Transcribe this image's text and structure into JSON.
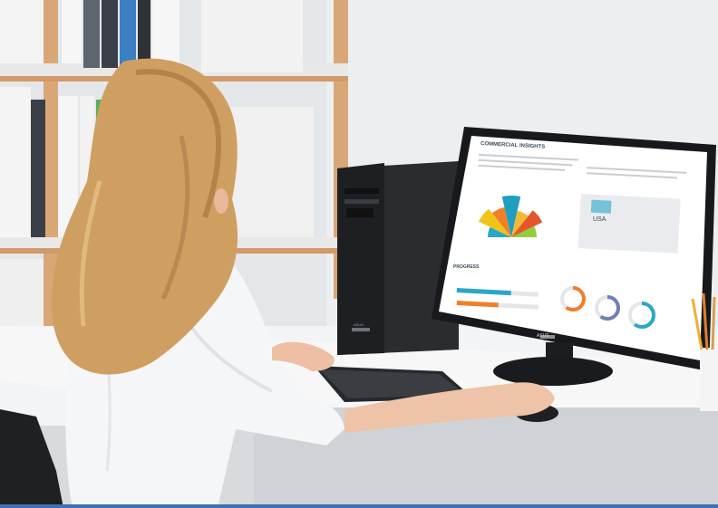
{
  "monitor": {
    "screen_title": "COMMERCIAL INSIGHTS",
    "map_label": "USA",
    "section_label": "PROGRESS",
    "brand": "ASUS"
  },
  "tower": {
    "brand": "ASUS"
  },
  "chart_panel": {
    "fan_colors": [
      "#2aa7c6",
      "#f0c419",
      "#f07f2a",
      "#1f9fbf",
      "#f5b833",
      "#e5552a",
      "#8fcf3a"
    ],
    "bar_colors": [
      "#2aa7c6",
      "#f07f2a"
    ],
    "ring_colors": [
      "#f07f2a",
      "#6f7fb0",
      "#2aa7c6"
    ]
  }
}
